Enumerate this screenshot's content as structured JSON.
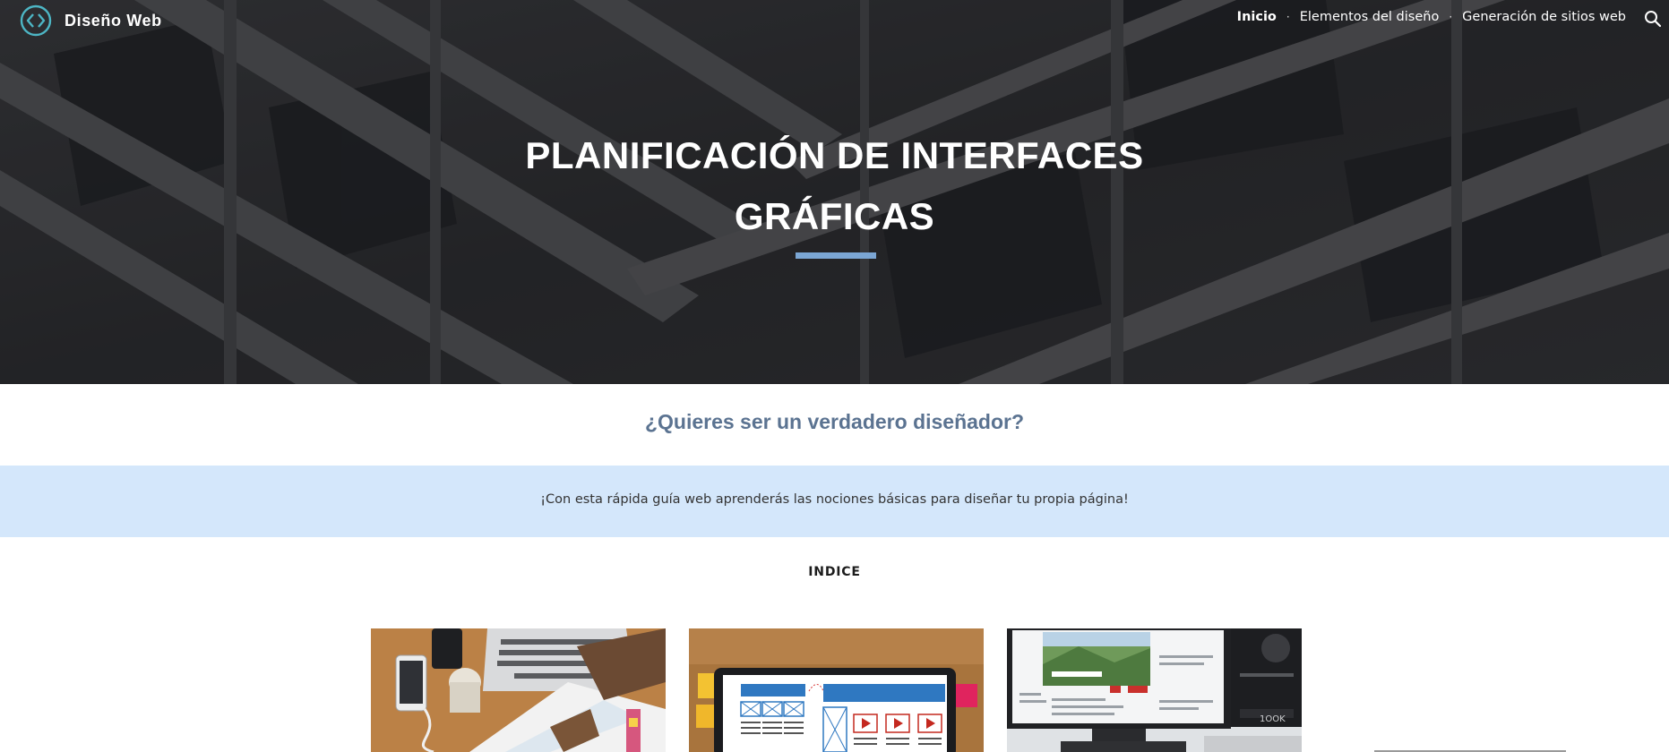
{
  "site": {
    "title": "Diseño Web",
    "logo_icon": "code-brackets-circle-icon",
    "accent_color": "#4db6c5"
  },
  "nav": {
    "items": [
      {
        "label": "Inicio",
        "active": true
      },
      {
        "label": "Elementos del diseño",
        "active": false
      },
      {
        "label": "Generación de sitios web",
        "active": false
      }
    ],
    "separator": "·",
    "search_icon": "search-icon"
  },
  "hero": {
    "title_line1": "PLANIFICACIÓN DE INTERFACES",
    "title_line2": "GRÁFICAS",
    "underline_color": "#7ba6d4"
  },
  "main": {
    "question": "¿Quieres ser un verdadero diseñador?",
    "banner_text": "¡Con esta rápida guía web aprenderás las nociones básicas para diseñar tu propia página!",
    "banner_color": "#d4e7fb",
    "index_heading": "INDICE"
  },
  "cards": [
    {
      "image": "desk-with-laptop-phone-and-documents"
    },
    {
      "image": "tablet-showing-wireframe-layout"
    },
    {
      "image": "monitor-showing-website-design"
    }
  ]
}
